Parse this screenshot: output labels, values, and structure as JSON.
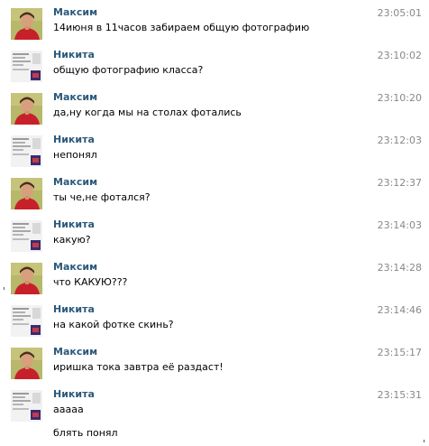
{
  "colors": {
    "name": "#2b587a",
    "time": "#888888",
    "text": "#000000"
  },
  "messages": [
    {
      "author": "Максим",
      "avatar": "photo-avatar-icon",
      "time": "23:05:01",
      "text": "14июня в 11часов забираем общую фотографию"
    },
    {
      "author": "Никита",
      "avatar": "collage-avatar-icon",
      "time": "23:10:02",
      "text": "общую фотографию класса?"
    },
    {
      "author": "Максим",
      "avatar": "photo-avatar-icon",
      "time": "23:10:20",
      "text": "да,ну когда мы на столах фотались"
    },
    {
      "author": "Никита",
      "avatar": "collage-avatar-icon",
      "time": "23:12:03",
      "text": "непонял"
    },
    {
      "author": "Максим",
      "avatar": "photo-avatar-icon",
      "time": "23:12:37",
      "text": "ты че,не фотался?"
    },
    {
      "author": "Никита",
      "avatar": "collage-avatar-icon",
      "time": "23:14:03",
      "text": "какую?"
    },
    {
      "author": "Максим",
      "avatar": "photo-avatar-icon",
      "time": "23:14:28",
      "text": "что КАКУЮ???"
    },
    {
      "author": "Никита",
      "avatar": "collage-avatar-icon",
      "time": "23:14:46",
      "text": "на какой фотке скинь?"
    },
    {
      "author": "Максим",
      "avatar": "photo-avatar-icon",
      "time": "23:15:17",
      "text": "иришка тока завтра её раздаст!"
    },
    {
      "author": "Никита",
      "avatar": "collage-avatar-icon",
      "time": "23:15:31",
      "text": "ааааа",
      "extra": "блять понял"
    }
  ]
}
